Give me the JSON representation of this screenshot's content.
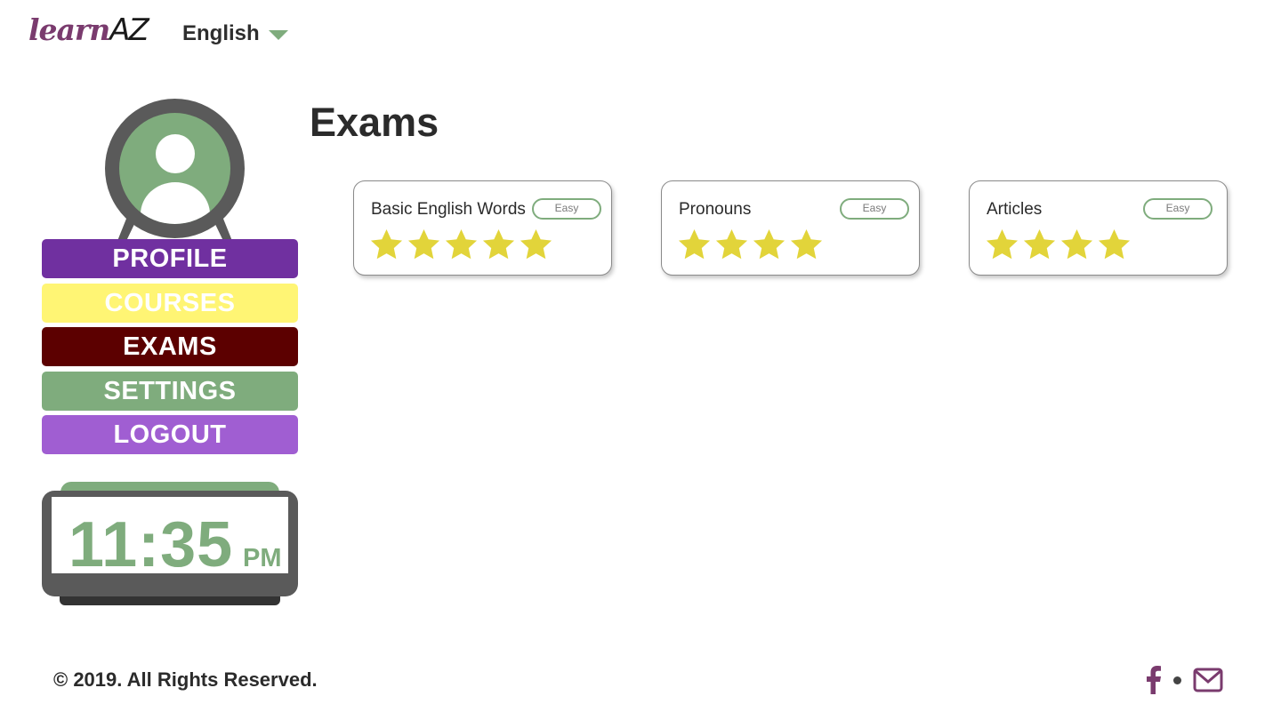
{
  "header": {
    "logo": {
      "learn": "learn",
      "az": "AZ"
    },
    "language": {
      "selected": "English"
    }
  },
  "sidebar": {
    "nav": [
      {
        "id": "profile",
        "label": "PROFILE"
      },
      {
        "id": "courses",
        "label": "COURSES"
      },
      {
        "id": "exams",
        "label": "EXAMS"
      },
      {
        "id": "settings",
        "label": "SETTINGS"
      },
      {
        "id": "logout",
        "label": "LOGOUT"
      }
    ],
    "clock": {
      "time": "11:35",
      "ampm": "PM"
    }
  },
  "main": {
    "title": "Exams",
    "exams": [
      {
        "title": "Basic English Words",
        "difficulty": "Easy",
        "stars": 5
      },
      {
        "title": "Pronouns",
        "difficulty": "Easy",
        "stars": 4
      },
      {
        "title": "Articles",
        "difficulty": "Easy",
        "stars": 4
      }
    ]
  },
  "footer": {
    "copyright": "© 2019. All Rights Reserved.",
    "social": [
      "facebook-icon",
      "mail-icon"
    ]
  },
  "colors": {
    "brand_purple": "#7a3b6e",
    "green": "#7fac7d",
    "profile": "#7030a0",
    "courses": "#fff574",
    "exams": "#5c0000",
    "settings": "#7fac7d",
    "logout": "#a05ed2",
    "star": "#e2d43a"
  }
}
